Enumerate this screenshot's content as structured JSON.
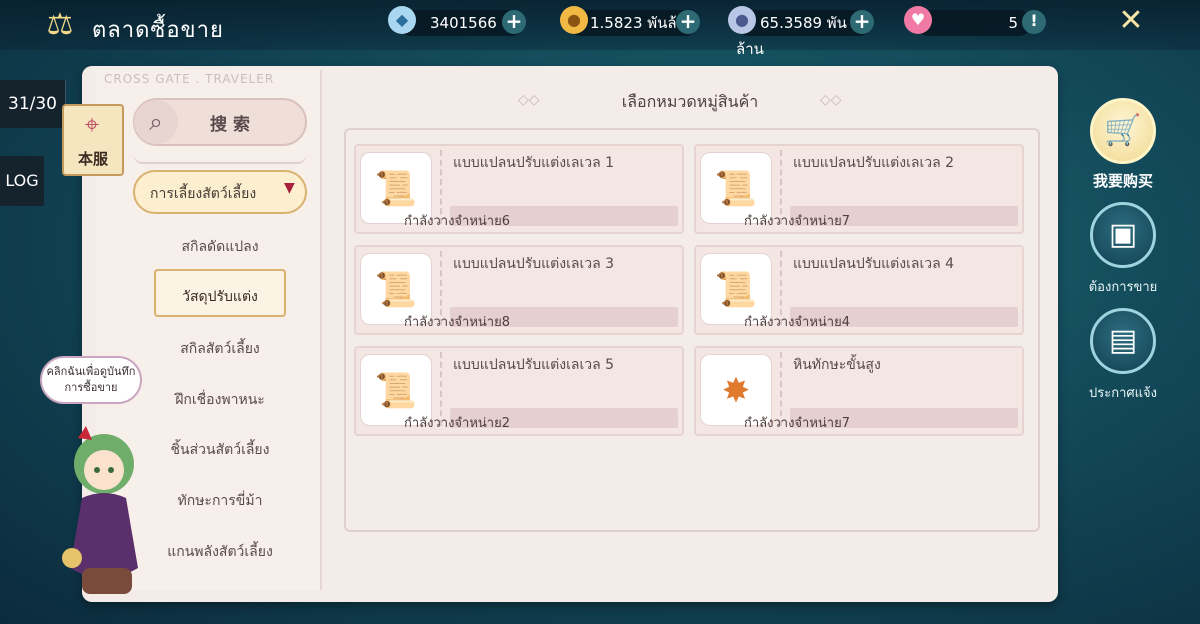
{
  "header": {
    "title": "ตลาดซื้อขาย",
    "title_icon": "scales-icon",
    "resources": [
      {
        "name": "diamond",
        "icon": "crystal-icon",
        "value": "3401566"
      },
      {
        "name": "gold",
        "icon": "coin-icon",
        "value": "1.5823 พันล้าน"
      },
      {
        "name": "silver",
        "icon": "silver-coin-icon",
        "value": "65.3589 พันล้าน"
      },
      {
        "name": "heart",
        "icon": "heart-icon",
        "value": "5"
      }
    ]
  },
  "left_strip": {
    "page_count": "31/30",
    "log_label": "LOG",
    "server_label": "本服"
  },
  "book": {
    "brand": "CROSS GATE . TRAVELER",
    "search_label": "搜 索",
    "category_open": "การเลี้ยงสัตว์เลี้ยง",
    "subcategories": [
      "สกิลดัดแปลง",
      "วัสดุปรับแต่ง",
      "สกิลสัตว์เลี้ยง",
      "ฝึกเชื่องพาหนะ",
      "ชิ้นส่วนสัตว์เลี้ยง",
      "ทักษะการขี่ม้า",
      "แกนพลังสัตว์เลี้ยง"
    ],
    "active_sub": "วัสดุปรับแต่ง",
    "panel_title": "เลือกหมวดหมู่สินค้า",
    "items": [
      {
        "name": "แบบแปลนปรับแต่งเลเวล 1",
        "status": "กำลังวางจำหน่าย6",
        "icon": "scroll-purple-icon",
        "color": "#7b4fb8"
      },
      {
        "name": "แบบแปลนปรับแต่งเลเวล 2",
        "status": "กำลังวางจำหน่าย7",
        "icon": "scroll-green-icon",
        "color": "#3fa66a"
      },
      {
        "name": "แบบแปลนปรับแต่งเลเวล 3",
        "status": "กำลังวางจำหน่าย8",
        "icon": "scroll-blue-icon",
        "color": "#3f6fc8"
      },
      {
        "name": "แบบแปลนปรับแต่งเลเวล 4",
        "status": "กำลังวางจำหน่าย4",
        "icon": "scroll-pink-icon",
        "color": "#c84fa8"
      },
      {
        "name": "แบบแปลนปรับแต่งเลเวล 5",
        "status": "กำลังวางจำหน่าย2",
        "icon": "scroll-gold-icon",
        "color": "#d99a2e"
      },
      {
        "name": "หินทักษะขั้นสูง",
        "status": "กำลังวางจำหน่าย7",
        "icon": "star-gem-icon",
        "color": "#e07a2e"
      }
    ]
  },
  "right_menu": [
    {
      "label": "我要购买",
      "icon": "cart-icon",
      "active": true
    },
    {
      "label": "ต้องการขาย",
      "icon": "wallet-icon",
      "active": false
    },
    {
      "label": "ประกาศแจ้ง",
      "icon": "notice-board-icon",
      "active": false
    }
  ],
  "mascot": {
    "bubble_text": "คลิกฉันเพื่อดูบันทึกการซื้อขาย"
  }
}
